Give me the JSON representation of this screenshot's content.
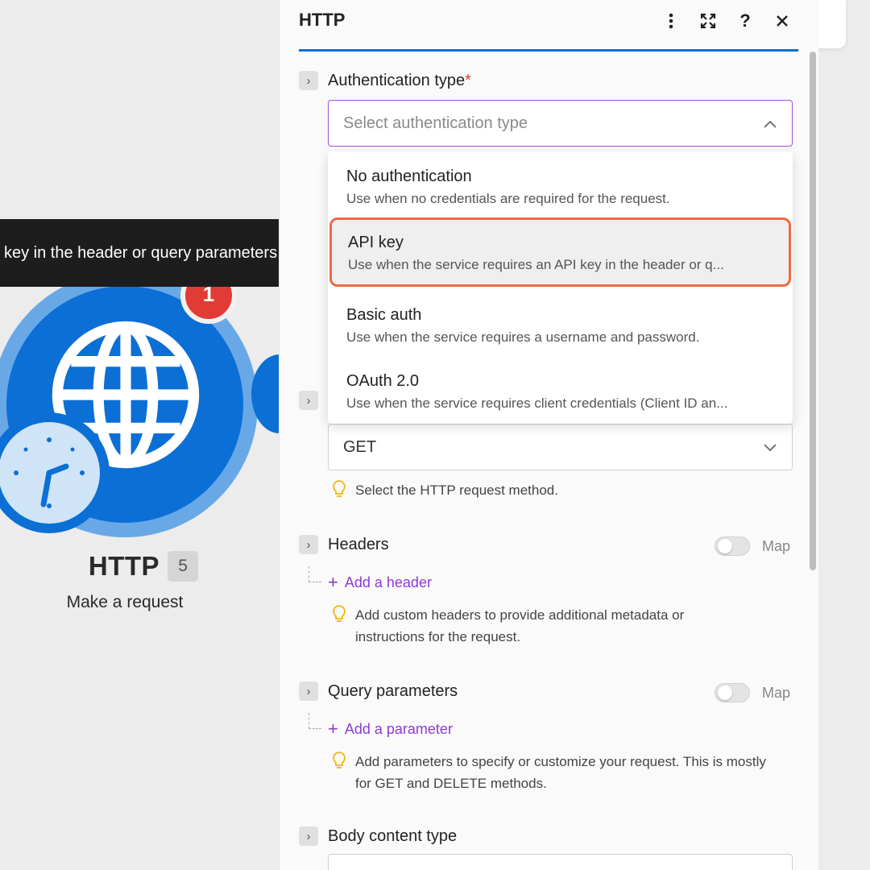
{
  "canvas": {
    "module_title": "HTTP",
    "module_badge": "5",
    "module_subtitle": "Make a request",
    "error_count": "1",
    "tooltip_text": "key in the header or query parameters."
  },
  "panel": {
    "title": "HTTP",
    "header_icons": [
      "more-vertical-icon",
      "expand-icon",
      "help-icon",
      "close-icon"
    ],
    "auth": {
      "label": "Authentication type",
      "required_mark": "*",
      "placeholder": "Select authentication type",
      "options": [
        {
          "title": "No authentication",
          "desc": "Use when no credentials are required for the request."
        },
        {
          "title": "API key",
          "desc": "Use when the service requires an API key in the header or q..."
        },
        {
          "title": "Basic auth",
          "desc": "Use when the service requires a username and password."
        },
        {
          "title": "OAuth 2.0",
          "desc": "Use when the service requires client credentials (Client ID an..."
        }
      ]
    },
    "method": {
      "value": "GET",
      "hint": "Select the HTTP request method."
    },
    "headers": {
      "label": "Headers",
      "map_label": "Map",
      "add_label": "Add a header",
      "hint": "Add custom headers to provide additional metadata or instructions for the request."
    },
    "query": {
      "label": "Query parameters",
      "map_label": "Map",
      "add_label": "Add a parameter",
      "hint": "Add parameters to specify or customize your request. This is mostly for GET and DELETE methods."
    },
    "body": {
      "label": "Body content type"
    }
  },
  "colors": {
    "accent_blue": "#0b6fd6",
    "link_purple": "#8e3ad8",
    "highlight_border": "#ec6a45",
    "error_red": "#e23b35"
  }
}
